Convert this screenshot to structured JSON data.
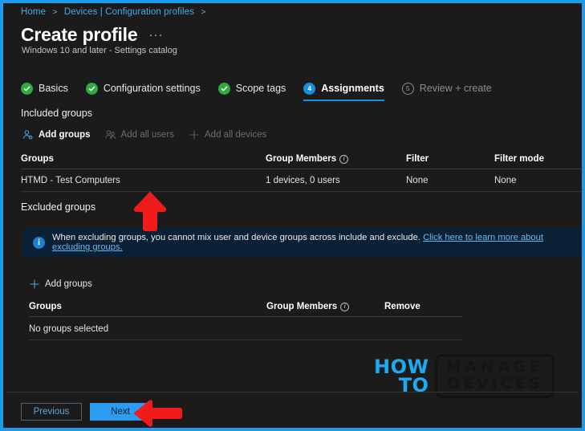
{
  "breadcrumb": {
    "items": [
      "Home",
      "Devices | Configuration profiles"
    ],
    "separator": ">"
  },
  "header": {
    "title": "Create profile",
    "ellipsis": "···",
    "subtitle": "Windows 10 and later - Settings catalog"
  },
  "steps": [
    {
      "number": "1",
      "label": "Basics",
      "state": "done"
    },
    {
      "number": "2",
      "label": "Configuration settings",
      "state": "done"
    },
    {
      "number": "3",
      "label": "Scope tags",
      "state": "done"
    },
    {
      "number": "4",
      "label": "Assignments",
      "state": "active"
    },
    {
      "number": "5",
      "label": "Review + create",
      "state": "pending"
    }
  ],
  "included": {
    "heading": "Included groups",
    "commands": [
      {
        "label": "Add groups",
        "icon": "add-user-icon",
        "enabled": true
      },
      {
        "label": "Add all users",
        "icon": "all-users-icon",
        "enabled": false
      },
      {
        "label": "Add all devices",
        "icon": "plus-icon",
        "enabled": false
      }
    ],
    "columns": [
      "Groups",
      "Group Members",
      "Filter",
      "Filter mode"
    ],
    "rows": [
      {
        "group": "HTMD - Test Computers",
        "members": "1 devices, 0 users",
        "filter": "None",
        "filter_mode": "None"
      }
    ]
  },
  "excluded": {
    "heading": "Excluded groups",
    "commands": [
      {
        "label": "Add groups",
        "icon": "plus-icon",
        "enabled": true
      }
    ],
    "banner": {
      "icon": "info-icon",
      "text": "When excluding groups, you cannot mix user and device groups across include and exclude.",
      "link": "Click here to learn more about excluding groups."
    },
    "columns": [
      "Groups",
      "Group Members",
      "Remove"
    ],
    "empty_text": "No groups selected"
  },
  "footer": {
    "previous_label": "Previous",
    "next_label": "Next"
  },
  "watermark": {
    "how": "HOW",
    "to": "TO",
    "manage": "MANAGE",
    "devices": "DEVICES"
  },
  "colors": {
    "frame_border": "#1b9bea",
    "accent_blue": "#2c9bf0",
    "link_blue": "#4aa8e8",
    "step_done_green": "#2faa3f",
    "banner_bg": "#0a2034",
    "arrow_red": "#f01c1c",
    "page_bg": "#1b1b1b"
  }
}
